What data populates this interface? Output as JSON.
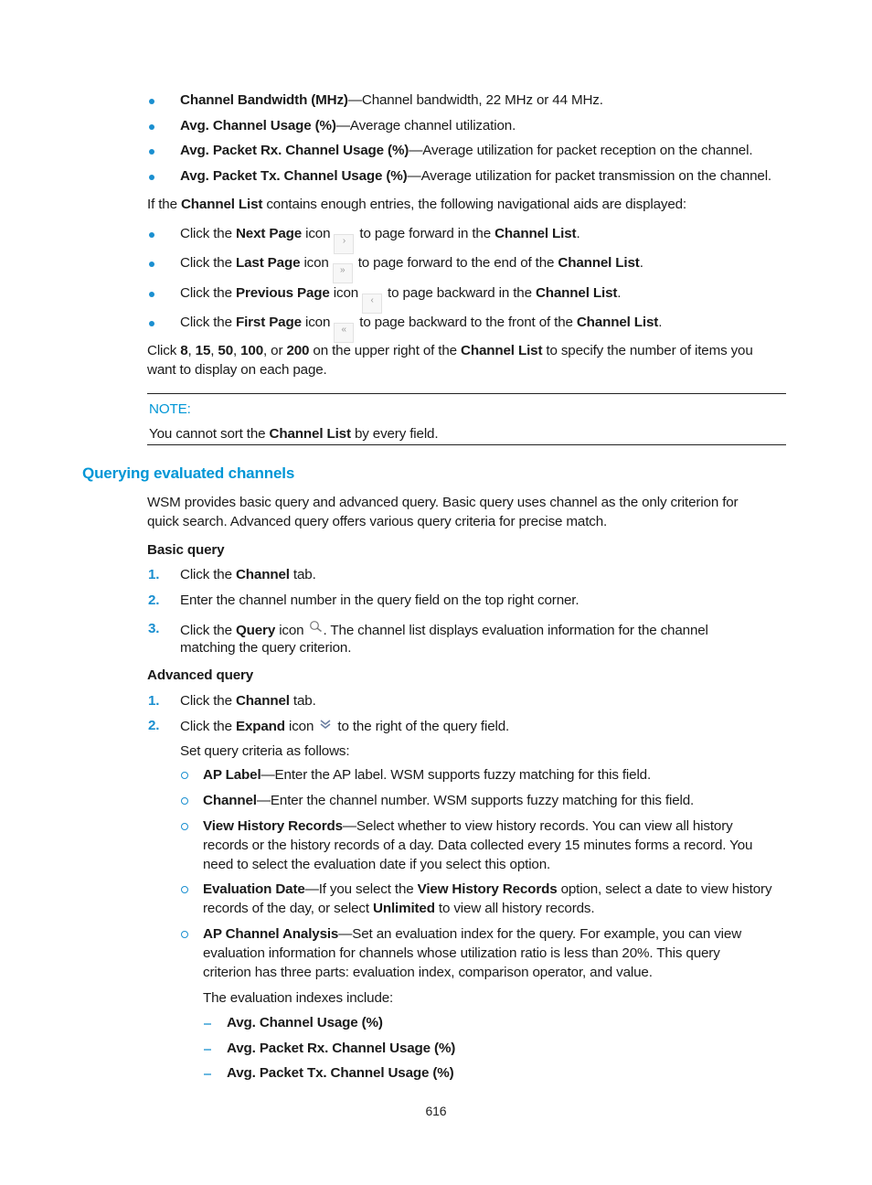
{
  "field_bullets": [
    {
      "term": "Channel Bandwidth (MHz)",
      "desc": "—Channel bandwidth, 22 MHz or 44 MHz."
    },
    {
      "term": "Avg. Channel Usage (%)",
      "desc": "—Average channel utilization."
    },
    {
      "term": "Avg. Packet Rx. Channel Usage (%)",
      "desc": "—Average utilization for packet reception on the channel."
    },
    {
      "term": "Avg. Packet Tx. Channel Usage (%)",
      "desc": "—Average utilization for packet transmission on the channel."
    }
  ],
  "nav_intro": {
    "pre": "If the ",
    "bold": "Channel List",
    "post": " contains enough entries, the following navigational aids are displayed:"
  },
  "nav_bullets": [
    {
      "pre": "Click the ",
      "bold": "Next Page",
      "mid": " icon",
      "icon": "next-page-icon",
      "glyph": "›",
      "post": "to page forward in the ",
      "bold2": "Channel List",
      "end": "."
    },
    {
      "pre": "Click the ",
      "bold": "Last Page",
      "mid": " icon",
      "icon": "last-page-icon",
      "glyph": "»",
      "post": "to page forward to the end of the ",
      "bold2": "Channel List",
      "end": "."
    },
    {
      "pre": "Click the ",
      "bold": "Previous Page",
      "mid": " icon",
      "icon": "previous-page-icon",
      "glyph": "‹",
      "post": "to page backward in the ",
      "bold2": "Channel List",
      "end": "."
    },
    {
      "pre": "Click the ",
      "bold": "First Page",
      "mid": " icon",
      "icon": "first-page-icon",
      "glyph": "«",
      "post": "to page backward to the front of the ",
      "bold2": "Channel List",
      "end": "."
    }
  ],
  "page_size": {
    "click": "Click ",
    "options": [
      "8",
      "15",
      "50",
      "100",
      "200"
    ],
    "sep1": ", ",
    "sep_or": ", or ",
    "mid": " on the upper right of the ",
    "bold": "Channel List",
    "post_line1": " to specify the number of items you",
    "line2": "want to display on each page."
  },
  "note": {
    "label": "NOTE:",
    "pre": "You cannot sort the ",
    "bold": "Channel List",
    "post": " by every field."
  },
  "section": {
    "title": "Querying evaluated channels",
    "intro_line1": "WSM provides basic query and advanced query. Basic query uses channel as the only criterion for",
    "intro_line2": "quick search. Advanced query offers various query criteria for precise match."
  },
  "basic_query": {
    "heading": "Basic query",
    "steps": [
      {
        "num": "1.",
        "pre": "Click the ",
        "bold": "Channel",
        "post": " tab."
      },
      {
        "num": "2.",
        "text": "Enter the channel number in the query field on the top right corner."
      },
      {
        "num": "3.",
        "pre": "Click the ",
        "bold": "Query",
        "mid": " icon ",
        "glyph": "🔍",
        "post": ". The channel list displays evaluation information for the channel",
        "line2": "matching the query criterion."
      }
    ]
  },
  "advanced_query": {
    "heading": "Advanced query",
    "steps": [
      {
        "num": "1.",
        "pre": "Click the ",
        "bold": "Channel",
        "post": " tab."
      },
      {
        "num": "2.",
        "pre": "Click the ",
        "bold": "Expand",
        "mid": " icon ",
        "glyph": "⩔",
        "post": " to the right of the query field."
      }
    ],
    "criteria_intro": "Set query criteria as follows:",
    "criteria": [
      {
        "term": "AP Label",
        "lines": [
          "—Enter the AP label. WSM supports fuzzy matching for this field."
        ]
      },
      {
        "term": "Channel",
        "lines": [
          "—Enter the channel number. WSM supports fuzzy matching for this field."
        ]
      },
      {
        "term": "View History Records",
        "lines": [
          "—Select whether to view history records. You can view all history",
          "records or the history records of a day. Data collected every 15 minutes forms a record. You",
          "need to select the evaluation date if you select this option."
        ]
      },
      {
        "term": "Evaluation Date",
        "lines": [
          "—If you select the ",
          "View History Records",
          " option, select a date to view history",
          "records of the day, or select ",
          "Unlimited",
          " to view all history records."
        ]
      },
      {
        "term": "AP Channel Analysis",
        "lines": [
          "—Set an evaluation index for the query. For example, you can view",
          "evaluation information for channels whose utilization ratio is less than 20%. This query",
          "criterion has three parts: evaluation index, comparison operator, and value."
        ]
      }
    ],
    "indexes_intro": "The evaluation indexes include:",
    "indexes": [
      "Avg. Channel Usage (%)",
      "Avg. Packet Rx. Channel Usage (%)",
      "Avg. Packet Tx. Channel Usage (%)"
    ]
  },
  "page_number": "616"
}
